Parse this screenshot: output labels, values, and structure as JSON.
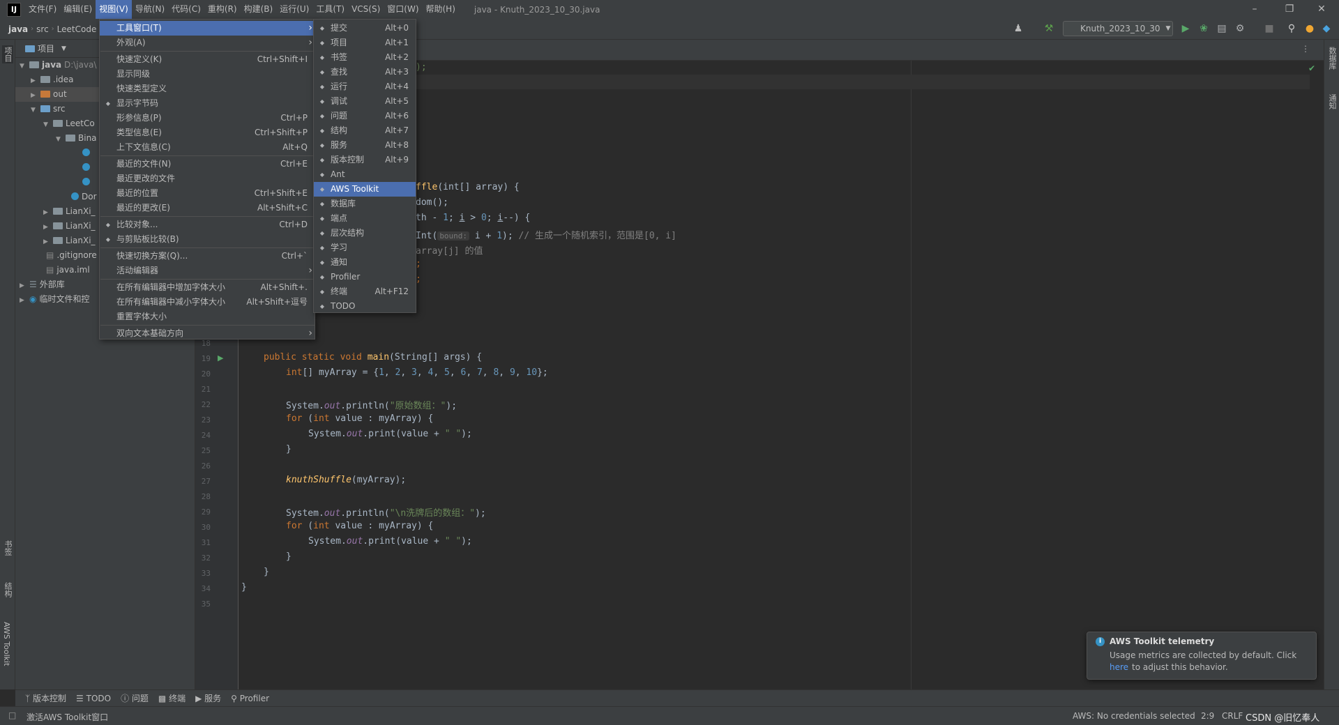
{
  "menubar": {
    "logo": "IJ",
    "items": [
      "文件(F)",
      "编辑(E)",
      "视图(V)",
      "导航(N)",
      "代码(C)",
      "重构(R)",
      "构建(B)",
      "运行(U)",
      "工具(T)",
      "VCS(S)",
      "窗口(W)",
      "帮助(H)"
    ],
    "window_title": "java - Knuth_2023_10_30.java"
  },
  "navbar": {
    "crumbs": [
      "java",
      "src",
      "LeetCode"
    ],
    "run_config": "Knuth_2023_10_30"
  },
  "left_stripe": {
    "top_tab": "项目",
    "tabs": [
      "书签",
      "结构",
      "AWS Toolkit"
    ]
  },
  "right_stripe": {
    "tabs": [
      "数据库",
      "通知"
    ]
  },
  "project": {
    "header": "项目",
    "tree": [
      {
        "label": "java",
        "extra": "D:\\java\\",
        "indent": 0,
        "open": true,
        "type": "folder"
      },
      {
        "label": ".idea",
        "indent": 1,
        "open": false,
        "type": "folder"
      },
      {
        "label": "out",
        "indent": 1,
        "open": false,
        "type": "folder-orange",
        "selected": true
      },
      {
        "label": "src",
        "indent": 1,
        "open": true,
        "type": "folder-blue"
      },
      {
        "label": "LeetCo",
        "indent": 2,
        "open": true,
        "type": "folder"
      },
      {
        "label": "Bina",
        "indent": 3,
        "open": true,
        "type": "folder"
      },
      {
        "label": "",
        "indent": 4,
        "type": "class"
      },
      {
        "label": "",
        "indent": 4,
        "type": "class"
      },
      {
        "label": "",
        "indent": 4,
        "type": "class"
      },
      {
        "label": "Dor",
        "indent": 3,
        "type": "class"
      },
      {
        "label": "LianXi_",
        "indent": 2,
        "open": false,
        "type": "folder"
      },
      {
        "label": "LianXi_",
        "indent": 2,
        "open": false,
        "type": "folder"
      },
      {
        "label": "LianXi_",
        "indent": 2,
        "open": false,
        "type": "folder"
      },
      {
        "label": ".gitignore",
        "indent": 1,
        "type": "file"
      },
      {
        "label": "java.iml",
        "indent": 1,
        "type": "file"
      },
      {
        "label": "外部库",
        "indent": 0,
        "open": false,
        "type": "lib"
      },
      {
        "label": "临时文件和控",
        "indent": 0,
        "open": false,
        "type": "scratch"
      }
    ]
  },
  "view_menu": {
    "items": [
      {
        "label": "工具窗口(T)",
        "shortcut": "",
        "submenu": true,
        "highlight": true
      },
      {
        "label": "外观(A)",
        "shortcut": "",
        "submenu": true
      },
      {
        "sep": true
      },
      {
        "label": "快速定义(K)",
        "shortcut": "Ctrl+Shift+I"
      },
      {
        "label": "显示同级",
        "shortcut": ""
      },
      {
        "label": "快速类型定义",
        "shortcut": ""
      },
      {
        "label": "显示字节码",
        "shortcut": "",
        "icon": "bytecode-icon"
      },
      {
        "label": "形参信息(P)",
        "shortcut": "Ctrl+P"
      },
      {
        "label": "类型信息(E)",
        "shortcut": "Ctrl+Shift+P"
      },
      {
        "label": "上下文信息(C)",
        "shortcut": "Alt+Q"
      },
      {
        "sep": true
      },
      {
        "label": "最近的文件(N)",
        "shortcut": "Ctrl+E"
      },
      {
        "label": "最近更改的文件",
        "shortcut": ""
      },
      {
        "label": "最近的位置",
        "shortcut": "Ctrl+Shift+E"
      },
      {
        "label": "最近的更改(E)",
        "shortcut": "Alt+Shift+C"
      },
      {
        "sep": true
      },
      {
        "label": "比较对象...",
        "shortcut": "Ctrl+D",
        "icon": "compare-icon"
      },
      {
        "label": "与剪贴板比较(B)",
        "shortcut": "",
        "icon": "clipboard-compare-icon"
      },
      {
        "sep": true
      },
      {
        "label": "快速切换方案(Q)...",
        "shortcut": "Ctrl+`"
      },
      {
        "label": "活动编辑器",
        "shortcut": "",
        "submenu": true
      },
      {
        "sep": true
      },
      {
        "label": "在所有编辑器中增加字体大小",
        "shortcut": "Alt+Shift+."
      },
      {
        "label": "在所有编辑器中减小字体大小",
        "shortcut": "Alt+Shift+逗号"
      },
      {
        "label": "重置字体大小",
        "shortcut": ""
      },
      {
        "sep": true
      },
      {
        "label": "双向文本基础方向",
        "shortcut": "",
        "submenu": true
      }
    ]
  },
  "tool_windows_menu": {
    "items": [
      {
        "label": "提交",
        "shortcut": "Alt+0",
        "icon": "commit-icon"
      },
      {
        "label": "项目",
        "shortcut": "Alt+1",
        "icon": "folder-icon"
      },
      {
        "label": "书签",
        "shortcut": "Alt+2",
        "icon": "bookmark-icon"
      },
      {
        "label": "查找",
        "shortcut": "Alt+3",
        "icon": "search-icon"
      },
      {
        "label": "运行",
        "shortcut": "Alt+4",
        "icon": "run-icon"
      },
      {
        "label": "调试",
        "shortcut": "Alt+5",
        "icon": "debug-icon"
      },
      {
        "label": "问题",
        "shortcut": "Alt+6",
        "icon": "problems-icon"
      },
      {
        "label": "结构",
        "shortcut": "Alt+7",
        "icon": "structure-icon"
      },
      {
        "label": "服务",
        "shortcut": "Alt+8",
        "icon": "services-icon"
      },
      {
        "label": "版本控制",
        "shortcut": "Alt+9",
        "icon": "vcs-icon"
      },
      {
        "label": "Ant",
        "shortcut": "",
        "icon": "ant-icon"
      },
      {
        "label": "AWS Toolkit",
        "shortcut": "",
        "icon": "aws-icon",
        "highlight": true
      },
      {
        "label": "数据库",
        "shortcut": "",
        "icon": "database-icon"
      },
      {
        "label": "端点",
        "shortcut": "",
        "icon": "endpoints-icon"
      },
      {
        "label": "层次结构",
        "shortcut": "",
        "icon": "hierarchy-icon"
      },
      {
        "label": "学习",
        "shortcut": "",
        "icon": "learn-icon"
      },
      {
        "label": "通知",
        "shortcut": "",
        "icon": "notifications-icon"
      },
      {
        "label": "Profiler",
        "shortcut": "",
        "icon": "profiler-icon"
      },
      {
        "label": "终端",
        "shortcut": "Alt+F12",
        "icon": "terminal-icon"
      },
      {
        "label": "TODO",
        "shortcut": "",
        "icon": "todo-icon"
      }
    ]
  },
  "editor": {
    "line_numbers": [
      "18",
      "19",
      "20",
      "21",
      "22",
      "23",
      "24",
      "25",
      "26",
      "27",
      "28",
      "29",
      "30",
      "31",
      "32",
      "33",
      "34",
      "35"
    ],
    "partial_top": {
      "l1": ");",
      "l2_fn": "ffle",
      "l2_rest": "(int[] array) {",
      "l3": "dom();",
      "l4_a": "th - ",
      "l4_b": "1",
      "l4_c": "; ",
      "l4_d": "i",
      "l4_e": " > ",
      "l4_f": "0",
      "l4_g": "; ",
      "l4_h": "i",
      "l4_i": "--) {",
      "l5_a": "Int(",
      "l5_hint": "bound:",
      "l5_b": " i + ",
      "l5_c": "1",
      "l5_d": "); ",
      "l5_cm": "// 生成一个随机索引，范围是[0, i]",
      "l6": "array[j] 的值",
      "l7": ";",
      "l8": ";"
    },
    "main_sig_kw": "public static void ",
    "main_sig_fn": "main",
    "main_sig_rest": "(String[] args) {",
    "arr_decl_a": "int",
    "arr_decl_b": "[] myArray = {",
    "arr_values": [
      "1",
      "2",
      "3",
      "4",
      "5",
      "6",
      "7",
      "8",
      "9",
      "10"
    ],
    "arr_decl_c": "};",
    "println1_a": "System.",
    "println1_out": "out",
    "println1_b": ".println(",
    "println1_str": "\"原始数组：\"",
    "println1_c": ");",
    "for_kw": "for",
    "for_a": " (",
    "for_int": "int",
    "for_b": " value : myArray) {",
    "print_a": "System.",
    "print_out": "out",
    "print_b": ".print(value + ",
    "print_str": "\" \"",
    "print_c": ");",
    "close": "}",
    "call_fn": "knuthShuffle",
    "call_rest": "(myArray);",
    "println2_str": "\"\\n洗牌后的数组：\""
  },
  "tool_strip": [
    "版本控制",
    "TODO",
    "问题",
    "终端",
    "服务",
    "Profiler"
  ],
  "status": {
    "left": "激活AWS Toolkit窗口",
    "aws": "AWS: No credentials selected",
    "pos": "2:9",
    "eol": "CRLF",
    "watermark": "CSDN @​旧忆奉人"
  },
  "notification": {
    "title": "AWS Toolkit telemetry",
    "body": "Usage metrics are collected by default. Click",
    "link": "here",
    "body2": "to adjust this behavior."
  },
  "colors": {
    "accent": "#4b6eaf",
    "bg": "#2b2b2b",
    "panel": "#3c3f41"
  }
}
